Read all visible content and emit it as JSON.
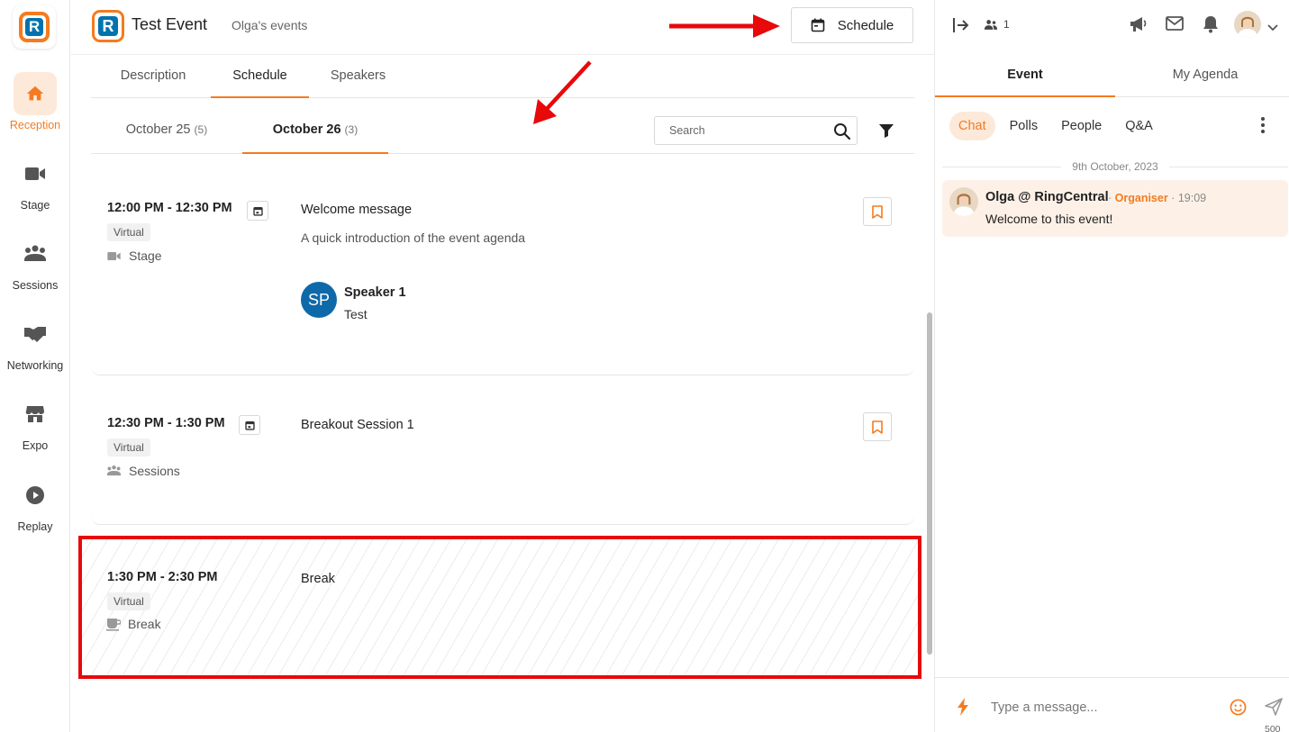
{
  "nav": {
    "items": [
      {
        "label": "Reception",
        "icon": "home-icon"
      },
      {
        "label": "Stage",
        "icon": "video-camera-icon"
      },
      {
        "label": "Sessions",
        "icon": "group-icon"
      },
      {
        "label": "Networking",
        "icon": "handshake-icon"
      },
      {
        "label": "Expo",
        "icon": "storefront-icon"
      },
      {
        "label": "Replay",
        "icon": "play-circle-icon"
      }
    ]
  },
  "header": {
    "title": "Test Event",
    "organizer": "Olga's events",
    "schedule_button": "Schedule"
  },
  "tabs": [
    "Description",
    "Schedule",
    "Speakers"
  ],
  "date_tabs": [
    {
      "label": "October 25",
      "count": "(5)"
    },
    {
      "label": "October 26",
      "count": "(3)"
    }
  ],
  "search": {
    "placeholder": "Search"
  },
  "sessions": [
    {
      "time": "12:00 PM - 12:30 PM",
      "badge": "Virtual",
      "location": "Stage",
      "title": "Welcome message",
      "description": "A quick introduction of the event agenda",
      "speaker": {
        "initials": "SP",
        "name": "Speaker 1",
        "role": "Test"
      }
    },
    {
      "time": "12:30 PM - 1:30 PM",
      "badge": "Virtual",
      "location": "Sessions",
      "title": "Breakout Session 1"
    },
    {
      "time": "1:30 PM - 2:30 PM",
      "badge": "Virtual",
      "location": "Break",
      "title": "Break"
    }
  ],
  "right_panel": {
    "attendee_count": "1",
    "tabs": [
      "Event",
      "My Agenda"
    ],
    "subtabs": [
      "Chat",
      "Polls",
      "People",
      "Q&A"
    ],
    "date_divider": "9th October, 2023",
    "message": {
      "author": "Olga @ RingCentral",
      "role": "Organiser",
      "time": "19:09",
      "text": "Welcome to this event!"
    },
    "composer": {
      "placeholder": "Type a message...",
      "char_limit": "500"
    }
  },
  "colors": {
    "accent": "#f47b20",
    "brand_blue": "#0073ae",
    "annotation_red": "#e8090b"
  }
}
